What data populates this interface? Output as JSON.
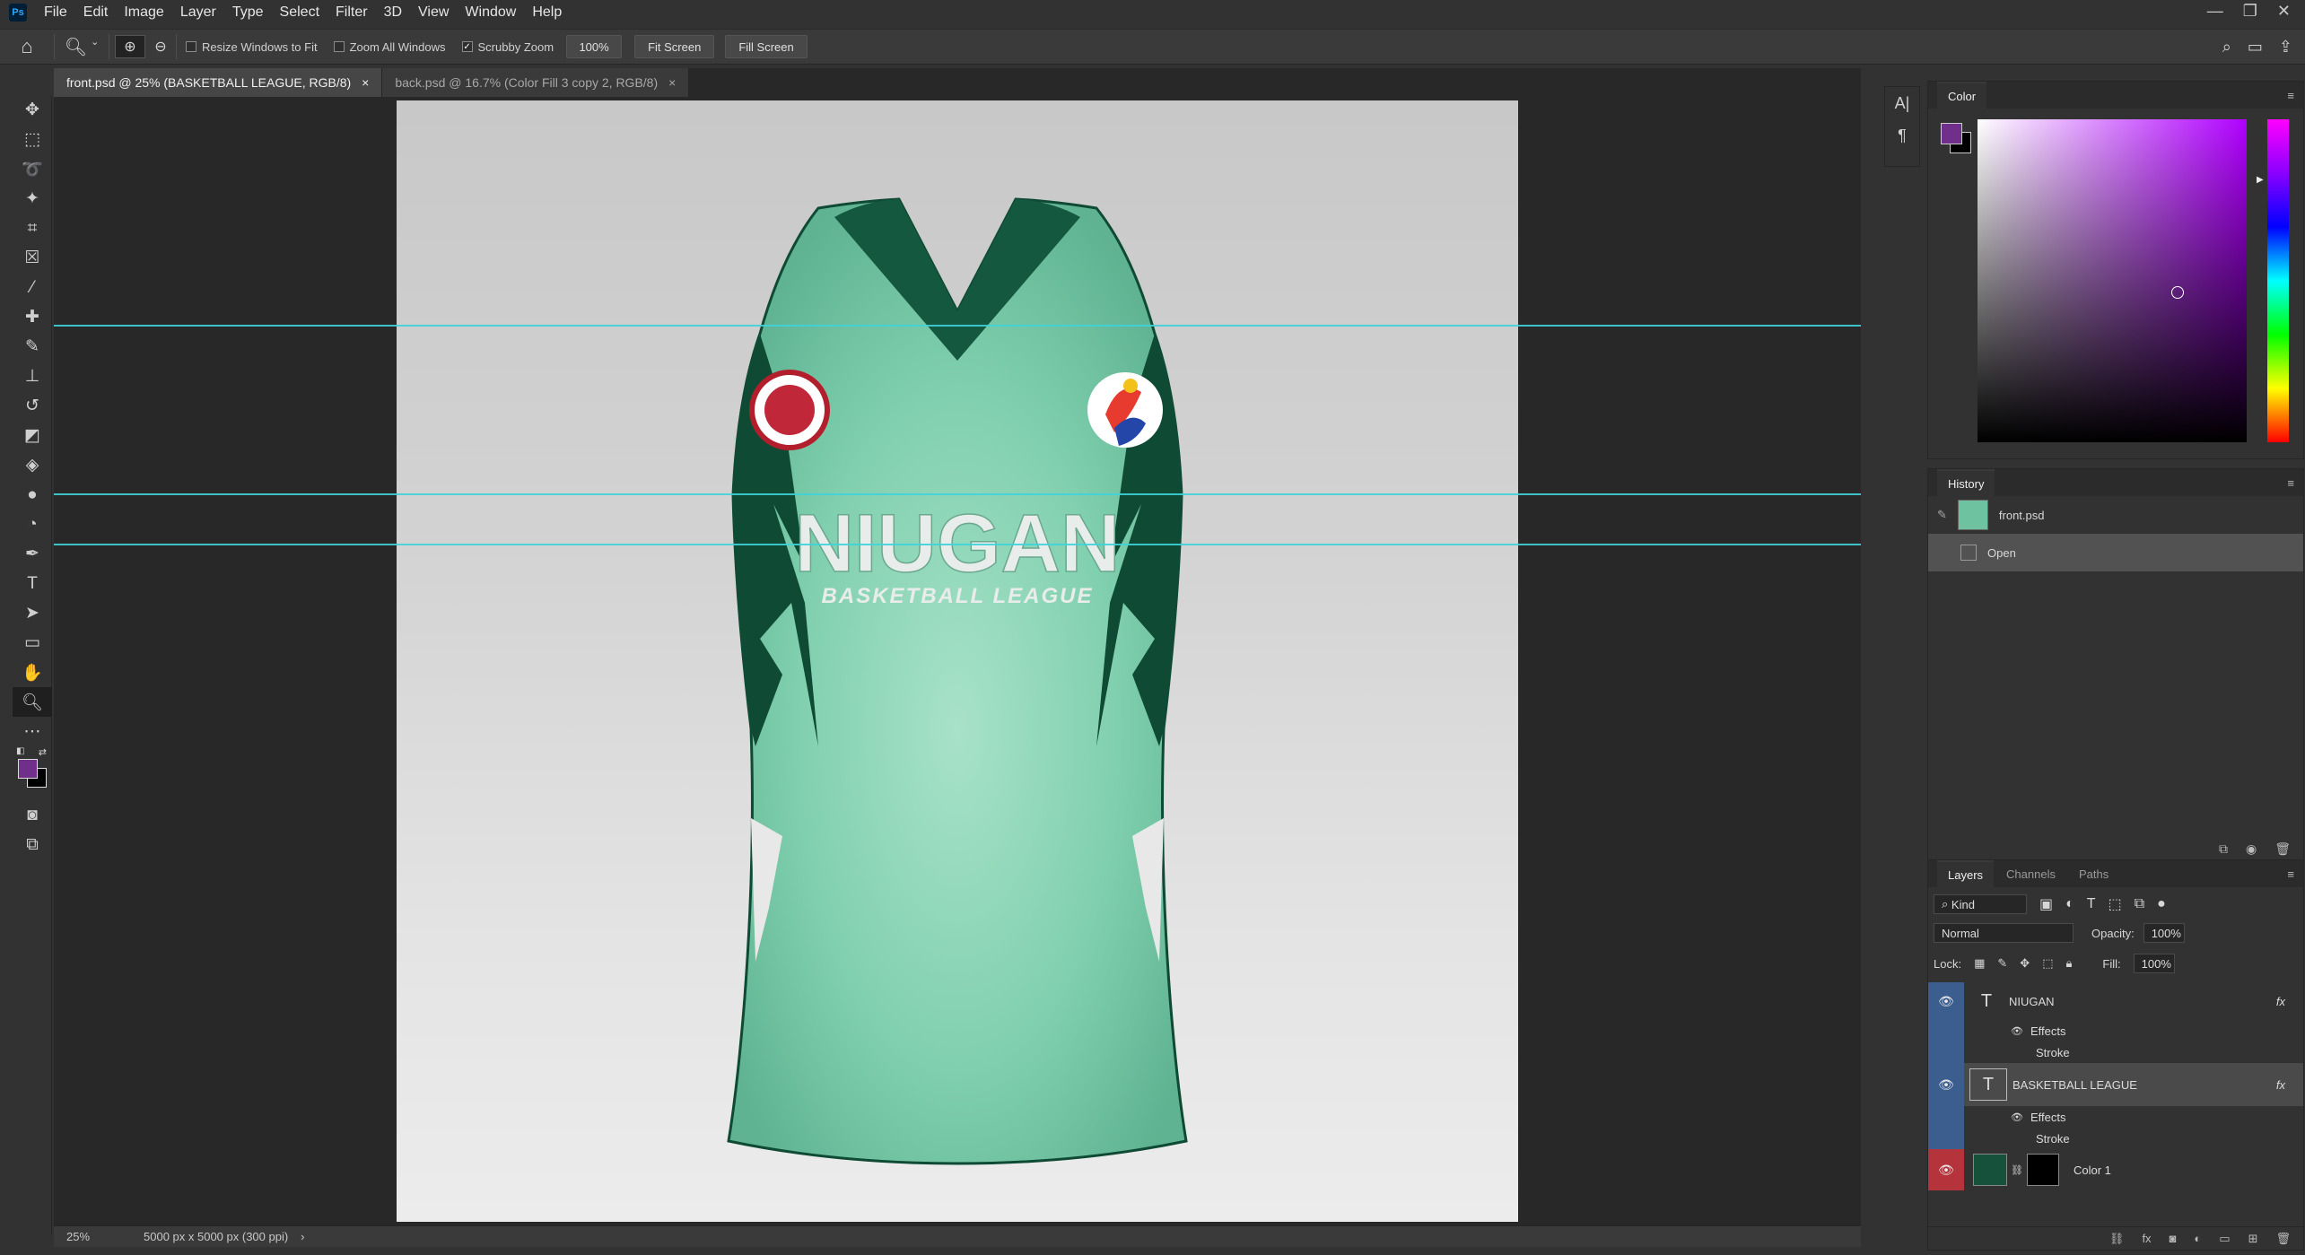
{
  "app": {
    "logo_text": "Ps",
    "menu": [
      "File",
      "Edit",
      "Image",
      "Layer",
      "Type",
      "Select",
      "Filter",
      "3D",
      "View",
      "Window",
      "Help"
    ],
    "window_controls": [
      "—",
      "❐",
      "✕"
    ]
  },
  "options_bar": {
    "resize_windows_to_fit": {
      "label": "Resize Windows to Fit",
      "checked": false
    },
    "zoom_all_windows": {
      "label": "Zoom All Windows",
      "checked": false
    },
    "scrubby_zoom": {
      "label": "Scrubby Zoom",
      "checked": true
    },
    "zoom_value": "100%",
    "fit_screen_label": "Fit Screen",
    "fill_screen_label": "Fill Screen"
  },
  "tabs": [
    {
      "label": "front.psd @ 25% (BASKETBALL LEAGUE, RGB/8)",
      "active": true
    },
    {
      "label": "back.psd @ 16.7% (Color Fill 3 copy 2, RGB/8)",
      "active": false
    }
  ],
  "canvas": {
    "jersey_title": "NIUGAN",
    "jersey_subtitle": "BASKETBALL LEAGUE",
    "jersey_color": "#7fcfae",
    "trim_color": "#0f4a34"
  },
  "status": {
    "zoom": "25%",
    "doc_size": "5000 px x 5000 px (300 ppi)",
    "arrow": "›"
  },
  "color_panel": {
    "title": "Color",
    "foreground": "#6f2f8a",
    "background": "#000000",
    "hue_color": "#b000ff"
  },
  "history_panel": {
    "title": "History",
    "snapshot_label": "front.psd",
    "items": [
      {
        "label": "Open",
        "selected": true
      }
    ]
  },
  "layers_panel": {
    "tabs": [
      "Layers",
      "Channels",
      "Paths"
    ],
    "filter_kind": "Kind",
    "blend_mode": "Normal",
    "opacity_label": "Opacity:",
    "opacity_value": "100%",
    "lock_label": "Lock:",
    "fill_label": "Fill:",
    "fill_value": "100%",
    "layers": [
      {
        "name": "NIUGAN",
        "type": "text",
        "fx": "fx",
        "effects_label": "Effects",
        "stroke_label": "Stroke",
        "selected": false
      },
      {
        "name": "BASKETBALL LEAGUE",
        "type": "text",
        "fx": "fx",
        "effects_label": "Effects",
        "stroke_label": "Stroke",
        "selected": true
      },
      {
        "name": "Color 1",
        "type": "fill",
        "fx": "",
        "selected": false
      }
    ]
  }
}
